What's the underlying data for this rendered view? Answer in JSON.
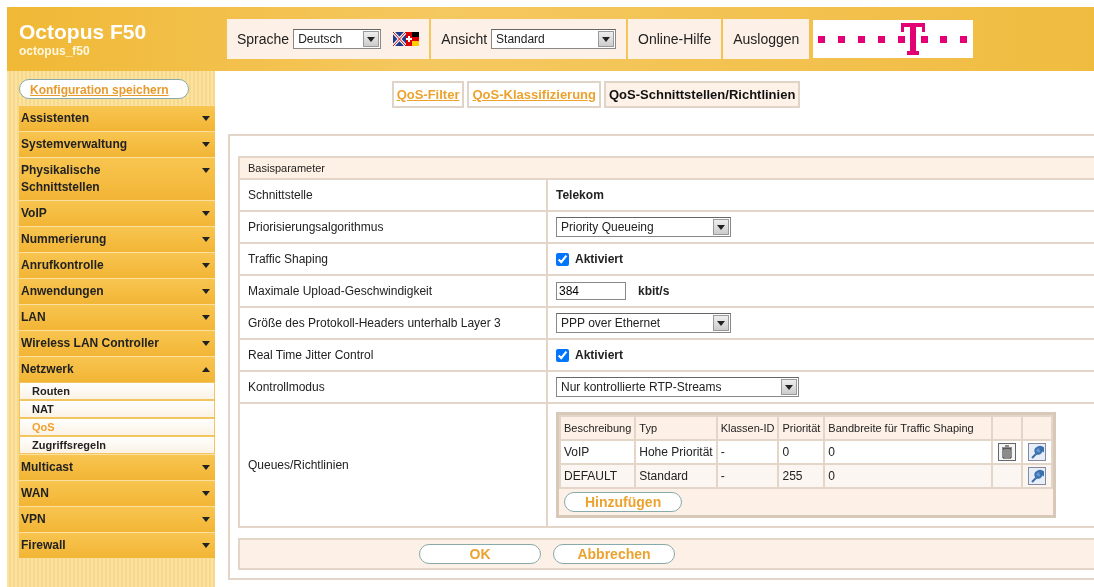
{
  "header": {
    "title": "Octopus F50",
    "subtitle": "octopus_f50",
    "language": {
      "label": "Sprache",
      "value": "Deutsch"
    },
    "view": {
      "label": "Ansicht",
      "value": "Standard"
    },
    "links": [
      "Online-Hilfe",
      "Ausloggen"
    ]
  },
  "save_button": "Konfiguration speichern",
  "sidebar": {
    "items": [
      {
        "label": "Assistenten",
        "expanded": false
      },
      {
        "label": "Systemverwaltung",
        "expanded": false
      },
      {
        "label": "Physikalische Schnittstellen",
        "expanded": false
      },
      {
        "label": "VoIP",
        "expanded": false
      },
      {
        "label": "Nummerierung",
        "expanded": false
      },
      {
        "label": "Anrufkontrolle",
        "expanded": false
      },
      {
        "label": "Anwendungen",
        "expanded": false
      },
      {
        "label": "LAN",
        "expanded": false
      },
      {
        "label": "Wireless LAN Controller",
        "expanded": false
      },
      {
        "label": "Netzwerk",
        "expanded": true,
        "children": [
          {
            "label": "Routen",
            "selected": false
          },
          {
            "label": "NAT",
            "selected": false
          },
          {
            "label": "QoS",
            "selected": true
          },
          {
            "label": "Zugriffsregeln",
            "selected": false
          }
        ]
      },
      {
        "label": "Multicast",
        "expanded": false
      },
      {
        "label": "WAN",
        "expanded": false
      },
      {
        "label": "VPN",
        "expanded": false
      },
      {
        "label": "Firewall",
        "expanded": false
      }
    ]
  },
  "tabs": [
    {
      "label": "QoS-Filter",
      "selected": false
    },
    {
      "label": "QoS-Klassifizierung",
      "selected": false
    },
    {
      "label": "QoS-Schnittstellen/Richtlinien",
      "selected": true
    }
  ],
  "section": {
    "title": "Basisparameter",
    "rows": [
      {
        "kind": "text",
        "label": "Schnittstelle",
        "value": "Telekom"
      },
      {
        "kind": "select",
        "label": "Priorisierungsalgorithmus",
        "value": "Priority Queueing"
      },
      {
        "kind": "checkbox",
        "label": "Traffic Shaping",
        "checked": true,
        "text": "Aktiviert"
      },
      {
        "kind": "input",
        "label": "Maximale Upload-Geschwindigkeit",
        "value": "384",
        "unit": "kbit/s"
      },
      {
        "kind": "select",
        "label": "Größe des Protokoll-Headers unterhalb Layer 3",
        "value": "PPP over Ethernet"
      },
      {
        "kind": "checkbox",
        "label": "Real Time Jitter Control",
        "checked": true,
        "text": "Aktiviert"
      },
      {
        "kind": "select",
        "label": "Kontrollmodus",
        "value": "Nur kontrollierte RTP-Streams"
      },
      {
        "kind": "table",
        "label": "Queues/Richtlinien",
        "columns": [
          "Beschreibung",
          "Typ",
          "Klassen-ID",
          "Priorität",
          "Bandbreite für Traffic Shaping"
        ],
        "rows": [
          {
            "cells": [
              "VoIP",
              "Hohe Priorität",
              "-",
              "0",
              "0"
            ],
            "deletable": true
          },
          {
            "cells": [
              "DEFAULT",
              "Standard",
              "-",
              "255",
              "0"
            ],
            "deletable": false
          }
        ],
        "add_button": "Hinzufügen"
      }
    ]
  },
  "buttons": [
    "OK",
    "Abbrechen"
  ]
}
